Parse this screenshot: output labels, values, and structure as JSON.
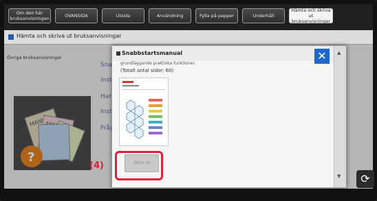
{
  "tabs": [
    "Om den här bruksanvisningen",
    "OVANSIDA",
    "Utsida",
    "Användning",
    "Fylla på papper",
    "Underhåll",
    "Hämta och skriva ut bruksanvisningar"
  ],
  "page": {
    "title": "Hämta och skriva ut bruksanvisningar",
    "left_label": "Övriga bruksanvisningar",
    "menu_items": [
      "Snab",
      "Instä",
      "Hanc",
      "Instä",
      "Frågo"
    ]
  },
  "dialog": {
    "title": "Snabbstartsmanual",
    "cut_text": "grundläggande praktiska funktioner.",
    "pages": "(Totalt antal sidor: 60)",
    "print_label": "Skriv ut"
  },
  "callout": {
    "step": "(4)"
  },
  "icons": {
    "close": "close-icon",
    "refresh": "refresh-icon",
    "scroll_up": "arrow-up-icon",
    "scroll_down": "arrow-down-icon"
  },
  "colors": {
    "accent": "#1f67c8",
    "highlight": "#e0203a"
  }
}
